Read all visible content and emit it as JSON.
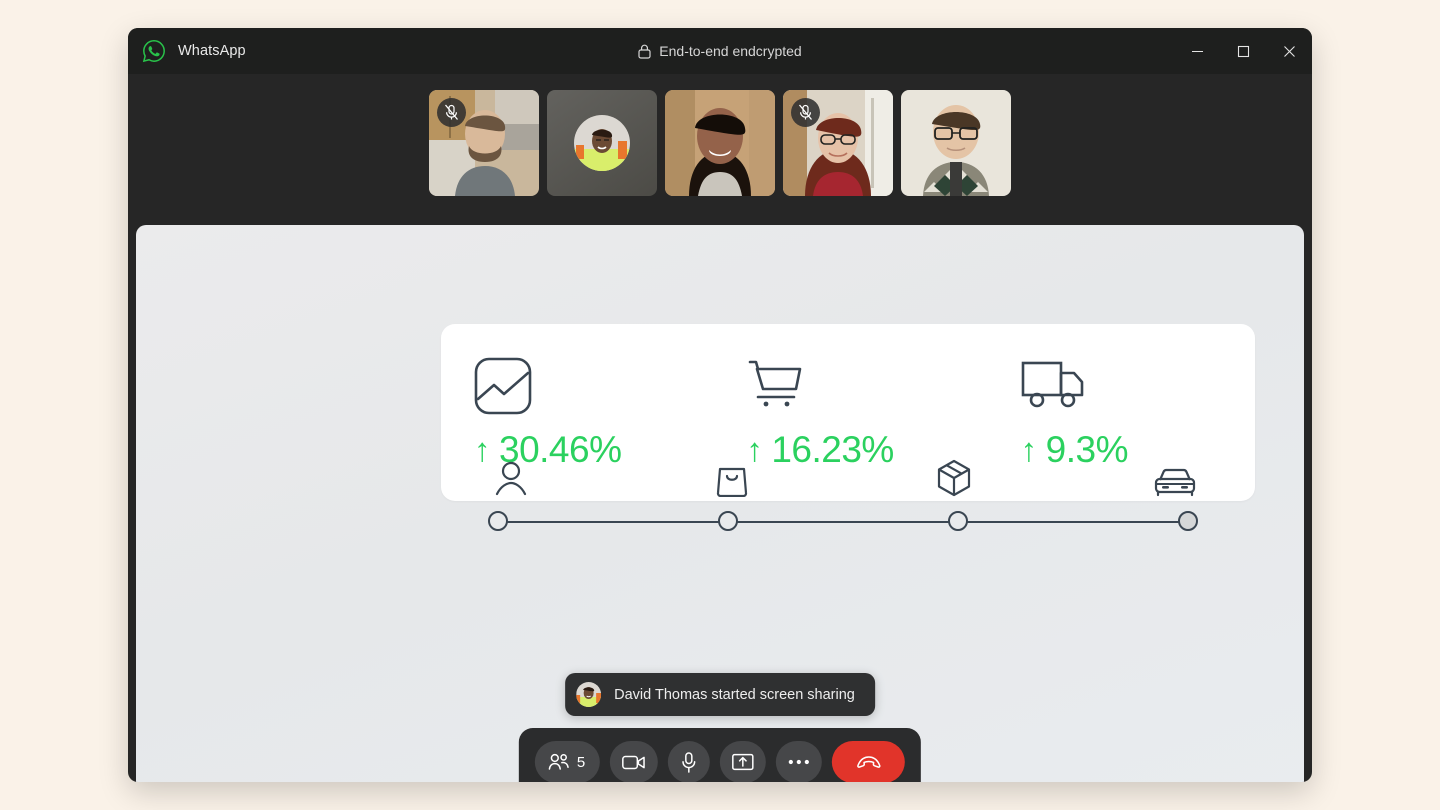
{
  "window": {
    "app_name": "WhatsApp",
    "logo_icon": "whatsapp-icon",
    "encryption_label": "End-to-end endcrypted",
    "lock_icon": "lock-icon",
    "controls": [
      {
        "name": "minimize-button",
        "icon": "minimize-icon"
      },
      {
        "name": "maximize-button",
        "icon": "maximize-icon"
      },
      {
        "name": "close-button",
        "icon": "close-icon"
      }
    ]
  },
  "call": {
    "participant_count": "5",
    "thumbnails": [
      {
        "id": "participant-1",
        "muted": true,
        "video_on": true,
        "skin": "#D9C4A8",
        "bg": "#B79A74",
        "shirt": "#6E7477",
        "hair": "#5A4430"
      },
      {
        "id": "participant-2",
        "muted": false,
        "video_on": false,
        "skin": "#6B4A34",
        "bg": "#5A5955",
        "shirt": "#D3EE63",
        "hair": "#271A12"
      },
      {
        "id": "participant-3",
        "muted": false,
        "video_on": true,
        "skin": "#8C5F42",
        "bg": "#C4A07A",
        "shirt": "#C9C5BC",
        "hair": "#1A120C"
      },
      {
        "id": "participant-4",
        "muted": true,
        "video_on": true,
        "skin": "#E2BFA6",
        "bg": "#D8CFC2",
        "shirt": "#A62630",
        "hair": "#6E2A1C"
      },
      {
        "id": "participant-5",
        "muted": false,
        "video_on": true,
        "skin": "#E3C3A6",
        "bg": "#E6E2D8",
        "shirt": "#7C7A6B",
        "hair": "#4A3726"
      }
    ]
  },
  "shared_screen": {
    "metrics": [
      {
        "icon": "chart-image-icon",
        "arrow": "↑",
        "value": "30.46%"
      },
      {
        "icon": "shopping-cart-icon",
        "arrow": "↑",
        "value": "16.23%"
      },
      {
        "icon": "delivery-truck-icon",
        "arrow": "↑",
        "value": "9.3%"
      }
    ],
    "stepper": [
      {
        "icon": "user-icon",
        "state": "open"
      },
      {
        "icon": "shopping-bag-icon",
        "state": "open"
      },
      {
        "icon": "package-box-icon",
        "state": "open"
      },
      {
        "icon": "car-icon",
        "state": "filled"
      }
    ],
    "accent_green": "#2BD15F",
    "ink": "#3A4652"
  },
  "toast": {
    "avatar_icon": "participant-avatar",
    "message": "David Thomas started screen sharing"
  },
  "controls": {
    "participants_label": "5",
    "buttons": [
      {
        "name": "participants-button",
        "icon": "people-icon"
      },
      {
        "name": "camera-button",
        "icon": "video-camera-icon"
      },
      {
        "name": "microphone-button",
        "icon": "microphone-icon"
      },
      {
        "name": "share-screen-button",
        "icon": "screen-share-icon"
      },
      {
        "name": "more-options-button",
        "icon": "ellipsis-icon"
      },
      {
        "name": "end-call-button",
        "icon": "phone-hangup-icon"
      }
    ],
    "end_call_color": "#E1342A"
  }
}
